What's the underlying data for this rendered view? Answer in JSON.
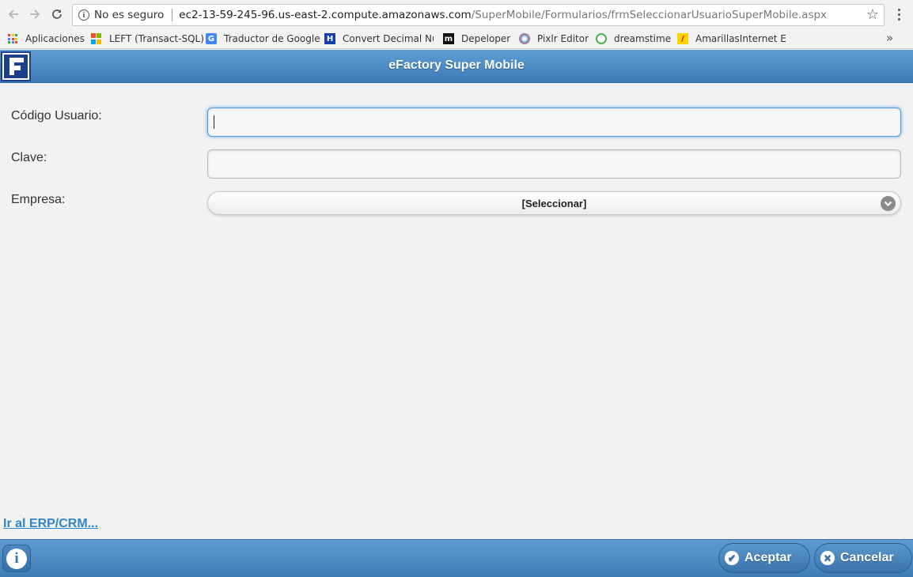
{
  "browser": {
    "security_label": "No es seguro",
    "url_host": "ec2-13-59-245-96.us-east-2.compute.amazonaws.com",
    "url_path": "/SuperMobile/Formularios/frmSeleccionarUsuarioSuperMobile.aspx",
    "bookmarks": [
      {
        "label": "Aplicaciones"
      },
      {
        "label": "LEFT (Transact-SQL)"
      },
      {
        "label": "Traductor de Google"
      },
      {
        "label": "Convert Decimal Nu"
      },
      {
        "label": "Depeloper"
      },
      {
        "label": "Pixlr Editor"
      },
      {
        "label": "dreamstime"
      },
      {
        "label": "AmarillasInternet Esp"
      }
    ]
  },
  "header": {
    "title": "eFactory Super Mobile"
  },
  "form": {
    "user_code_label": "Código Usuario:",
    "user_code_value": "",
    "password_label": "Clave:",
    "password_value": "",
    "company_label": "Empresa:",
    "company_selected": "[Seleccionar]"
  },
  "links": {
    "erp": "Ir al ERP/CRM..."
  },
  "footer": {
    "accept_label": "Aceptar",
    "cancel_label": "Cancelar"
  },
  "colors": {
    "header_blue": "#4a8bc4",
    "link_blue": "#2f86c8",
    "logo_navy": "#1b3f8b"
  }
}
